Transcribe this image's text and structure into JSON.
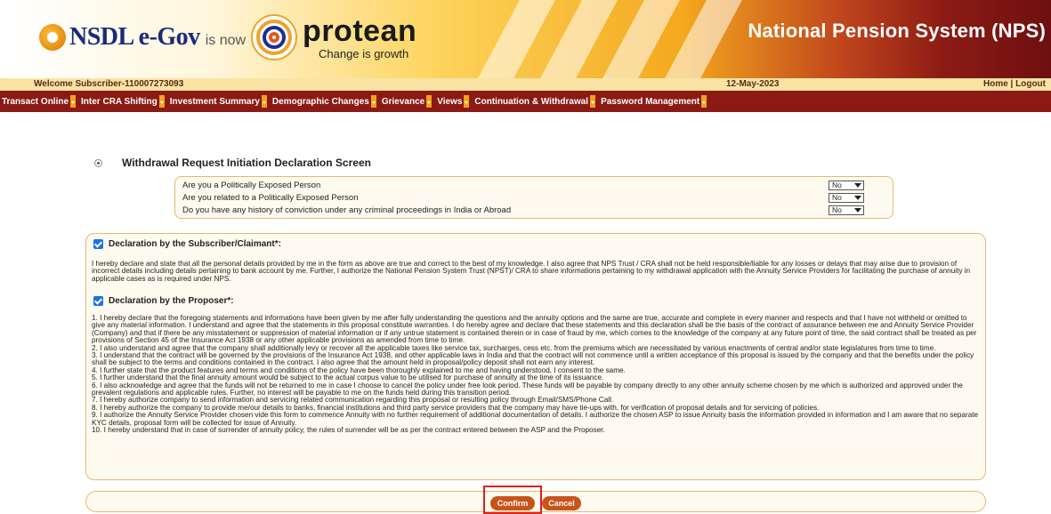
{
  "header": {
    "brand_primary": "NSDL e-Gov",
    "brand_is_now": "is now",
    "brand_protean": "protean",
    "tagline": "Change is growth",
    "system_title": "National Pension System (NPS)"
  },
  "welcome_bar": {
    "welcome_text": "Welcome Subscriber-110007273093",
    "date": "12-May-2023",
    "links": "Home | Logout"
  },
  "nav": {
    "items": [
      {
        "label": "Transact Online"
      },
      {
        "label": "Inter CRA Shifting"
      },
      {
        "label": "Investment Summary"
      },
      {
        "label": "Demographic Changes"
      },
      {
        "label": "Grievance"
      },
      {
        "label": "Views"
      },
      {
        "label": "Continuation & Withdrawal"
      },
      {
        "label": "Password Management"
      }
    ]
  },
  "page": {
    "title": "Withdrawal Request Initiation Declaration Screen"
  },
  "pep": {
    "questions": [
      {
        "question": "Are you a Politically Exposed Person",
        "value": "No"
      },
      {
        "question": "Are you related to a Politically Exposed Person",
        "value": "No"
      },
      {
        "question": "Do you have any history of conviction under any criminal proceedings in India or Abroad",
        "value": "No"
      }
    ]
  },
  "declaration": {
    "subscriber_heading": "Declaration by the Subscriber/Claimant*:",
    "subscriber_text": "I hereby declare and state that all the personal details provided by me in the form as above are true and correct to the best of my knowledge. I also agree that NPS Trust / CRA shall not be held responsible/liable for any losses or delays that may arise due to provision of incorrect details including details pertaining to bank account by me. Further, I authorize the National Pension System Trust (NPST)/ CRA to share informations pertaining to my withdrawal application with the Annuity Service Providers for facilitating the purchase of annuity in applicable cases as is required under NPS.",
    "proposer_heading": "Declaration by the Proposer*:",
    "proposer_points": [
      "1. I hereby declare that the foregoing statements and informations have been given by me after fully understanding the questions and the annuity options and the same are true, accurate and complete in every manner and respects and that I have not withheld or omitted to give any material information. I understand and agree that the statements in this proposal constitute warranties. I do hereby agree and declare that these statements and this declaration shall be the basis of the contract of assurance between me and Annuity Service Provider (Company) and that if there be any misstatement or suppression of material information or if any untrue statement is contained therein or in case of fraud by me, which comes to the knowledge of the company at any future point of time, the said contract shall be treated as per provisions of Section 45 of the Insurance Act 1938 or any other applicable provisions as amended from time to time.",
      "2. I also understand and agree that the company shall additionally levy or recover all the applicable taxes like service tax, surcharges, cess etc. from the premiums which are necessitated by various enactments of central and/or state legislatures from time to time.",
      "3. I understand that the contract will be governed by the provisions of the Insurance Act 1938, and other applicable laws in India and that the contract will not commence until a written acceptance of this proposal is issued by the company and that the benefits under the policy shall be subject to the terms and conditions contained in the contract. I also agree that the amount held in proposal/policy deposit shall not earn any interest.",
      "4. I further state that the product features and terms and conditions of the policy have been thoroughly explained to me and having understood, I consent to the same.",
      "5. I further understand that the final annuity amount would be subject to the actual corpus value to be utilised for purchase of annuity at the time of its issuance.",
      "6. I also acknowledge and agree that the funds will not be returned to me in case I choose to cancel the policy under free look period. These funds will be payable by company directly to any other annuity scheme chosen by me which is authorized and approved under the prevalent regulations and applicable rules. Further, no interest will be payable to me on the funds held during this transition period.",
      "7. I hereby authorize company to send information and servicing related communication regarding this proposal or resulting policy through Email/SMS/Phone Call.",
      "8. I hereby authorize the company to provide me/our details to banks, financial institutions and third party service providers that the company may have tie-ups with, for verification of proposal details and for servicing of policies.",
      "9. I authorize the Annuity Service Provider chosen vide this form to commence Annuity with no further requirement of additional documentation of details. I authorize the chosen ASP to issue Annuity basis the information provided in information and I am aware that no separate KYC details, proposal form will be collected for issue of Annuity.",
      "10. I hereby understand that in case of surrender of annuity policy, the rules of surrender will be as per the contract entered between the ASP and the Proposer."
    ]
  },
  "buttons": {
    "confirm": "Confirm",
    "cancel": "Cancel"
  },
  "colors": {
    "nav_bg": "#8b1a14",
    "button_bg": "#c8541a",
    "box_border": "#e3b972",
    "highlight": "#e0201a"
  }
}
